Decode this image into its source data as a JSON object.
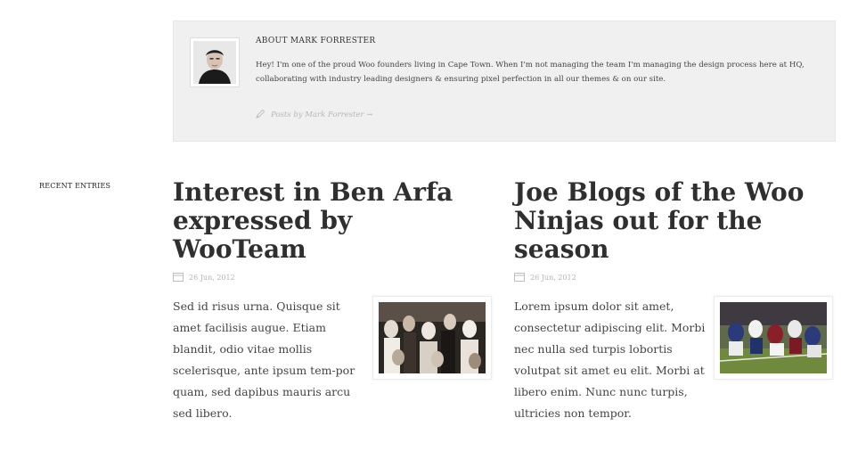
{
  "author_box": {
    "title": "ABOUT MARK FORRESTER",
    "bio": "Hey! I'm one of the proud Woo founders living in Cape Town. When I'm not managing the team I'm managing the design process here at HQ, collaborating with industry leading designers & ensuring pixel perfection in all our themes & on our site.",
    "posts_link": "Posts by Mark Forrester →",
    "icons": {
      "avatar": "author-photo",
      "posts": "pencil-icon"
    }
  },
  "sidebar": {
    "recent_label": "RECENT ENTRIES"
  },
  "entries": [
    {
      "title": "Interest in Ben Arfa expressed by WooTeam",
      "date": "26 Jun, 2012",
      "excerpt": "Sed id risus urna. Quisque sit amet facilisis augue. Etiam blandit, odio vitae mollis scelerisque, ante ipsum tem-por quam, sed dapibus mauris arcu sed libero.",
      "thumbnail": "crowd-photo"
    },
    {
      "title": "Joe Blogs of the Woo Ninjas out for the season",
      "date": "26 Jun, 2012",
      "excerpt": "Lorem ipsum dolor sit amet, consectetur adipiscing elit. Morbi nec nulla sed turpis lobortis volutpat sit amet eu elit. Morbi at libero enim. Nunc nunc turpis, ultricies non tempor.",
      "thumbnail": "football-photo"
    }
  ],
  "colors": {
    "author_box_bg": "#f0f0f0",
    "title_text": "#2f2f2f",
    "body_text": "#444444",
    "muted_text": "#b4b4b4"
  }
}
